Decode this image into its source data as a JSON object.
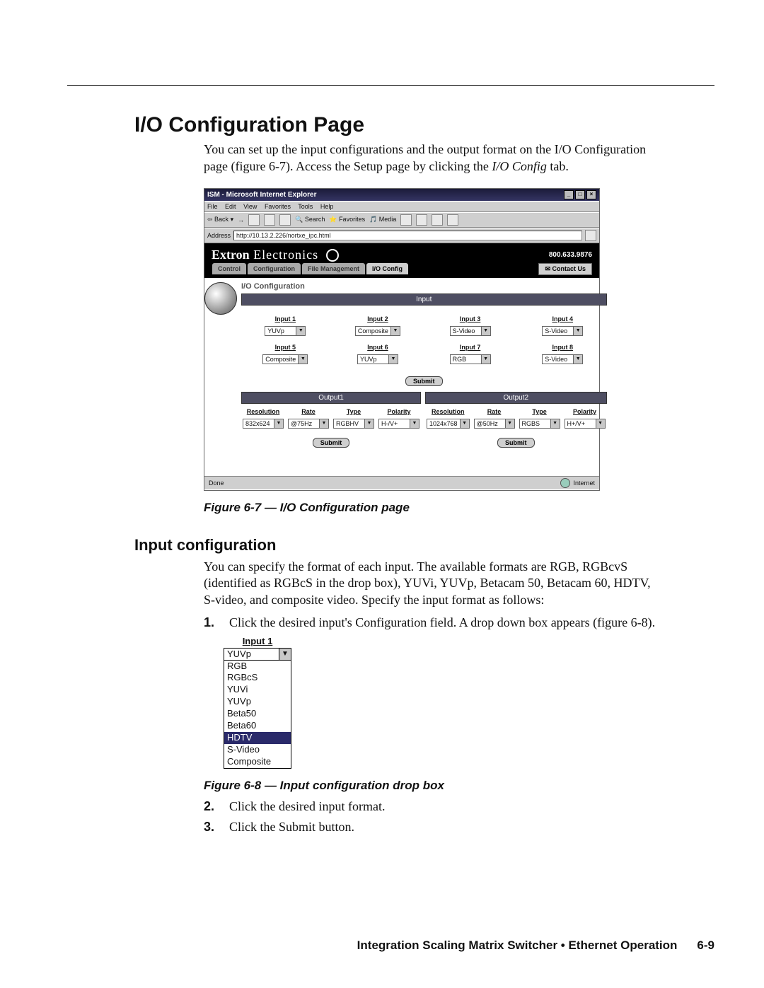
{
  "page": {
    "heading": "I/O Configuration Page",
    "intro_1": "You can set up the input configurations and the output format on the I/O Configuration page (figure 6-7).  Access the Setup page by clicking the ",
    "intro_italic": "I/O Config",
    "intro_2": " tab.",
    "fig67_caption": "Figure 6-7 — I/O Configuration page",
    "subheading": "Input configuration",
    "para2": "You can specify the format of each input.  The available formats are RGB, RGBcvS (identified as RGBcS in the drop box), YUVi, YUVp, Betacam 50, Betacam 60, HDTV, S-video, and composite video.  Specify the input format as follows:",
    "step1": "Click the desired input's Configuration field.  A drop down box appears (figure 6-8).",
    "fig68_caption": "Figure 6-8 — Input configuration drop box",
    "step2": "Click the desired input format.",
    "step3_a": "Click the ",
    "step3_italic": "Submit",
    "step3_b": " button."
  },
  "footer": {
    "title": "Integration Scaling Matrix Switcher • Ethernet Operation",
    "page_no": "6-9"
  },
  "ie": {
    "title": "ISM - Microsoft Internet Explorer",
    "menu": [
      "File",
      "Edit",
      "View",
      "Favorites",
      "Tools",
      "Help"
    ],
    "toolbar": {
      "back": "Back",
      "search": "Search",
      "favorites": "Favorites",
      "media": "Media"
    },
    "address_label": "Address",
    "url": "http://10.13.2.226/nortxe_ipc.html",
    "status_done": "Done",
    "status_zone": "Internet"
  },
  "extron": {
    "brand_bold": "Extron",
    "brand_rest": " Electronics",
    "phone": "800.633.9876",
    "tabs": [
      "Control",
      "Configuration",
      "File Management",
      "I/O Config"
    ],
    "active_tab_index": 3,
    "contact": "Contact Us",
    "section_title": "I/O Configuration",
    "input_banner": "Input",
    "inputs": [
      {
        "label": "Input 1",
        "value": "YUVp"
      },
      {
        "label": "Input 2",
        "value": "Composite"
      },
      {
        "label": "Input 3",
        "value": "S-Video"
      },
      {
        "label": "Input 4",
        "value": "S-Video"
      },
      {
        "label": "Input 5",
        "value": "Composite"
      },
      {
        "label": "Input 6",
        "value": "YUVp"
      },
      {
        "label": "Input 7",
        "value": "RGB"
      },
      {
        "label": "Input 8",
        "value": "S-Video"
      }
    ],
    "submit": "Submit",
    "output1_banner": "Output1",
    "output2_banner": "Output2",
    "out_headers": [
      "Resolution",
      "Rate",
      "Type",
      "Polarity"
    ],
    "output1": {
      "resolution": "832x624",
      "rate": "75Hz",
      "type": "RGBHV",
      "polarity": "H-/V+"
    },
    "output2": {
      "resolution": "1024x768",
      "rate": "50Hz",
      "type": "RGBS",
      "polarity": "H+/V+"
    }
  },
  "dropbox": {
    "label": "Input 1",
    "selected": "YUVp",
    "options": [
      "RGB",
      "RGBcS",
      "YUVi",
      "YUVp",
      "Beta50",
      "Beta60",
      "HDTV",
      "S-Video",
      "Composite"
    ],
    "highlight_index": 6
  }
}
